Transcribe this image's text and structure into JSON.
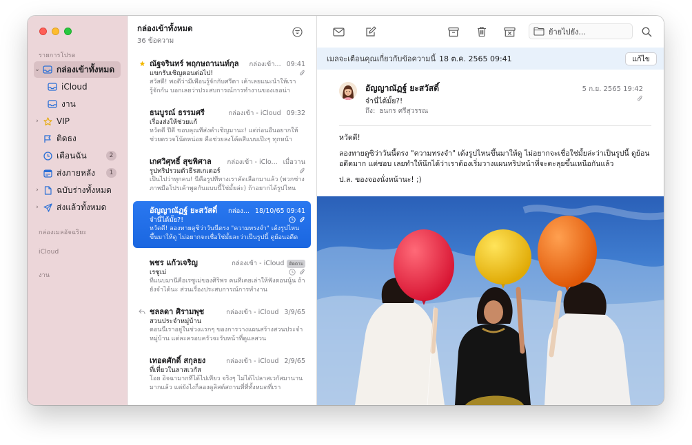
{
  "sidebar": {
    "favorites_label": "รายการโปรด",
    "items": [
      {
        "label": "กล่องเข้าทั้งหมด",
        "icon": "inbox-icon",
        "badge": ""
      },
      {
        "label": "iCloud",
        "icon": "inbox-icon",
        "badge": ""
      },
      {
        "label": "งาน",
        "icon": "inbox-icon",
        "badge": ""
      },
      {
        "label": "VIP",
        "icon": "star-icon",
        "badge": ""
      },
      {
        "label": "ติดธง",
        "icon": "flag-icon",
        "badge": ""
      },
      {
        "label": "เตือนฉัน",
        "icon": "clock-icon",
        "badge": "2"
      },
      {
        "label": "ส่งภายหลัง",
        "icon": "calendar-icon",
        "badge": "1"
      },
      {
        "label": "ฉบับร่างทั้งหมด",
        "icon": "document-icon",
        "badge": ""
      },
      {
        "label": "ส่งแล้วทั้งหมด",
        "icon": "paperplane-icon",
        "badge": ""
      }
    ],
    "smart_mailboxes_label": "กล่องเมลอัจฉริยะ",
    "icloud_label": "iCloud",
    "work_label": "งาน"
  },
  "list": {
    "title": "กล่องเข้าทั้งหมด",
    "count": "36 ข้อความ",
    "messages": [
      {
        "sender": "ณัฐจรินทร์ พฤกษถานนท์กุล",
        "mailbox": "กล่องเข้า...",
        "date": "09:41",
        "subject": "แขกรับเชิญตอนต่อไป!",
        "preview": "สวัสดี! พอดีว่ามีเพื่อนรู้จักกับศรีตา เค้าเลยแนะนำให้เรารู้จักกัน บอกเลยว่าประสบการณ์การทำงานของเธอน่า"
      },
      {
        "sender": "ธนบูรณ์ ธรรมศรี",
        "mailbox": "กล่องเข้า - iCloud",
        "date": "09:32",
        "subject": "เรื่องส่งให้ช่วยแก้",
        "preview": "หวัดดี ปีดี ขอบคุณที่ส่งคำเชิญมานะ! แต่ก่อนอื่นอยากให้ช่วยตรวจโน้ตหน่อย คือช่วยลงโค้ดสีแบบเป๊ะๆ ทุกหน้า"
      },
      {
        "sender": "เกศวิศุทธิ์ สุขพิศาล",
        "mailbox": "กล่องเข้า - iClo...",
        "date": "เมื่อวาน",
        "subject": "รูปทริปรวมตัวธีรสเกเตอร์",
        "preview": "เป็นไปว่าทุกคน! นี่คือรูปที่ทางเราคัดเลือกมาแล้ว (พวกช่างภาพมือโปรเค้าพูดกันแบบนี้ใช่มั้ยล่ะ) ถ้าอยากได้รูปไหน"
      },
      {
        "sender": "อัญญาณัฏฐ์ ยะสวัสดิ์",
        "mailbox": "กล่อง...",
        "date": "18/10/65 09:41",
        "subject": "จำนี่ได้มั้ย?!",
        "preview": "หวัดดี! ลองทายดูซิว่าวันนี้ตรง \"ความทรงจำ\" เด้งรูปไหนขึ้นมาให้ดู ไม่อยากจะเชื่อใช่มั้ยละว่าเป็นรูปนี้ ดูย้อนอดีตมาก"
      },
      {
        "sender": "พชร แก้วเจริญ",
        "mailbox": "กล่องเข้า - iCloud",
        "date": "",
        "badge": "ติดตาม",
        "subject": "เรซูเม่",
        "preview": "ที่แนบมานี่คือเรซูเม่ของศิริพร คนที่เคยเล่าให้ฟังตอนนู้น ถ้ายังจำได้นะ ส่วนเรื่องประสบการณ์การทำงาน"
      },
      {
        "sender": "ชลลดา ศิรามพุช",
        "mailbox": "กล่องเข้า - iCloud",
        "date": "3/9/65",
        "subject": "สวนประจำหมู่บ้าน",
        "preview": "ตอนนี้เราอยู่ในช่วงแรกๆ ของการวางแผนสร้างสวนประจำหมู่บ้าน แต่ละครอบครัวจะรับหน้าที่ดูแลสวน"
      },
      {
        "sender": "เทอดศักดิ์ สกุลยง",
        "mailbox": "กล่องเข้า - iCloud",
        "date": "2/9/65",
        "subject": "ที่เที่ยวในลาสเวกัส",
        "preview": "โอย อิจฉามากที่ได้ไปเที่ยว จริงๆ ไม่ได้ไปลาสเวกัสมานานมากแล้ว แต่ยังไงก็ลองดูลิสต์สถานที่ที่ทั้งหมดที่เรา"
      }
    ]
  },
  "reader": {
    "move_placeholder": "ย้ายไปยัง...",
    "reminder_text": "เมลจะเตือนคุณเกี่ยวกับข้อความนี้",
    "reminder_date": "18 ต.ค. 2565 09:41",
    "edit_label": "แก้ไข",
    "from_name": "อัญญาณัฏฐ์ ยะสวัสดิ์",
    "subject": "จำนี่ได้มั้ย?!",
    "to_label": "ถึง:",
    "to_name": "ธนกร ศรีสุวรรณ",
    "date": "5 ก.ย. 2565 19:42",
    "body": {
      "greeting": "หวัดดี!",
      "paragraph": "ลองทายดูซิว่าวันนี้ตรง \"ความทรงจำ\" เด้งรูปไหนขึ้นมาให้ดู ไม่อยากจะเชื่อใช่มั้ยล่ะว่าเป็นรูปนี้ ดูย้อนอดีตมาก แต่ชอบ เลยทำให้นึกได้ว่าเราต้องเริ่มวางแผนทริปหน้าที่จะตะลุยขึ้นเหนือกันแล้ว",
      "ps": "ป.ล. ของจองนั่งหน้านะ! ;)"
    }
  },
  "colors": {
    "sidebar_bg": "#ecd6d9",
    "selection_blue": "#1a66e0",
    "reminder_bg": "#e8f1fb",
    "balloon_red": "#e8253f",
    "balloon_yellow": "#f3c81b",
    "balloon_orange": "#f4761a"
  }
}
